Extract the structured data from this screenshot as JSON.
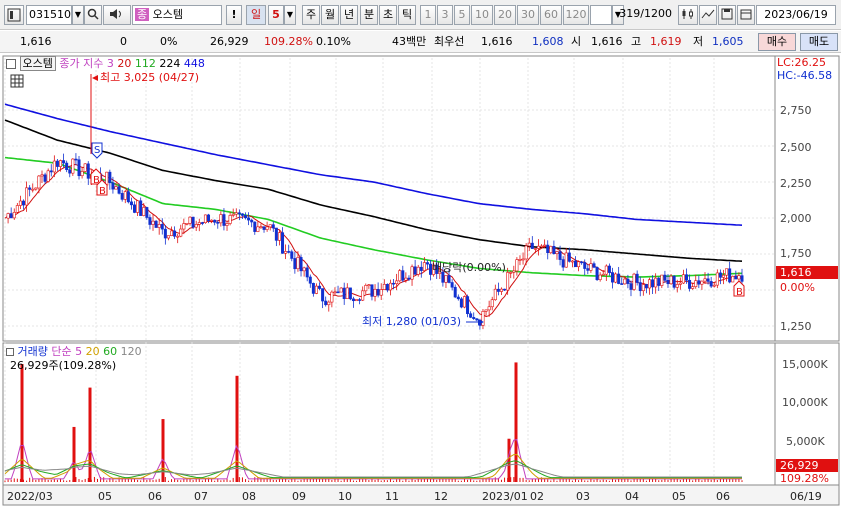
{
  "toolbar": {
    "code": "031510",
    "name": "오스템",
    "name_badge": "종",
    "excl": "!",
    "period_day": "일",
    "period_num": "5",
    "week": "주",
    "month": "월",
    "year": "년",
    "minute": "분",
    "second": "초",
    "tick": "틱",
    "intervals": [
      "1",
      "3",
      "5",
      "10",
      "20",
      "30",
      "60",
      "120"
    ],
    "count": "319/1200",
    "date": "2023/06/19"
  },
  "infobar": {
    "price": "1,616",
    "change": "0",
    "change_pct": "0%",
    "volume": "26,929",
    "vol_ratio": "109.28%",
    "turnover": "0.10%",
    "amount": "43백만",
    "best": "최우선",
    "bid": "1,616",
    "ask": "1,608",
    "open_label": "시",
    "open": "1,616",
    "high_label": "고",
    "high": "1,619",
    "low_label": "저",
    "low": "1,605",
    "sell_btn": "매수",
    "buy_btn": "매도"
  },
  "price_panel": {
    "title": "오스템",
    "legend_main": "종가 지수 3",
    "ma_periods": [
      "20",
      "112",
      "224",
      "448"
    ],
    "lc": "LC:26.25",
    "hc": "HC:-46.58",
    "y_ticks": [
      "2,750",
      "2,500",
      "2,250",
      "2,000",
      "1,750",
      "1,250"
    ],
    "y_zero": "0.00%",
    "current_price": "1,616",
    "high_annotation": "최고 3,025 (04/27)",
    "low_annotation": "최저 1,280 (01/03)",
    "dividend_annotation": "배당락(0.00%)",
    "marker_s": "S",
    "marker_b": "B"
  },
  "volume_panel": {
    "legend_title": "거래량",
    "legend_simple": "단순 5",
    "ma_periods": [
      "20",
      "60",
      "120"
    ],
    "current_label": "26,929주(109.28%)",
    "y_ticks": [
      "15,000K",
      "10,000K",
      "5,000K"
    ],
    "current_value": "26,929",
    "current_pct": "109.28%"
  },
  "x_axis": {
    "labels": [
      "2022/03",
      "05",
      "06",
      "07",
      "08",
      "09",
      "10",
      "11",
      "12",
      "2023/01",
      "02",
      "03",
      "04",
      "05",
      "06"
    ],
    "right_label": "06/19"
  },
  "colors": {
    "up": "#e01010",
    "down": "#1030d0",
    "ma20": "#d01010",
    "ma112": "#22cc22",
    "ma224": "#000000",
    "ma448": "#1010e0",
    "volume_bar": "#e01010"
  },
  "chart_data": {
    "type": "candlestick",
    "x": [
      "2022/03",
      "05",
      "06",
      "07",
      "08",
      "09",
      "10",
      "11",
      "12",
      "2023/01",
      "02",
      "03",
      "04",
      "05",
      "06"
    ],
    "close_approx": [
      2000,
      2400,
      2250,
      1900,
      2000,
      1950,
      1450,
      1500,
      1700,
      1300,
      1800,
      1650,
      1550,
      1560,
      1616
    ],
    "ma448_approx": [
      2790,
      2690,
      2600,
      2520,
      2440,
      2370,
      2300,
      2250,
      2170,
      2100,
      2060,
      2030,
      1990,
      1970,
      1950
    ],
    "ma224_approx": [
      2680,
      2540,
      2450,
      2330,
      2260,
      2200,
      2090,
      2010,
      1920,
      1850,
      1800,
      1780,
      1750,
      1720,
      1700
    ],
    "ma112_approx": [
      2420,
      2380,
      2250,
      2100,
      2060,
      1990,
      1860,
      1780,
      1710,
      1650,
      1620,
      1600,
      1590,
      1600,
      1616
    ],
    "high": 3025,
    "low": 1280,
    "volume_spikes_k": [
      15000,
      7000,
      12000,
      8000,
      13500,
      5500,
      15200
    ]
  }
}
